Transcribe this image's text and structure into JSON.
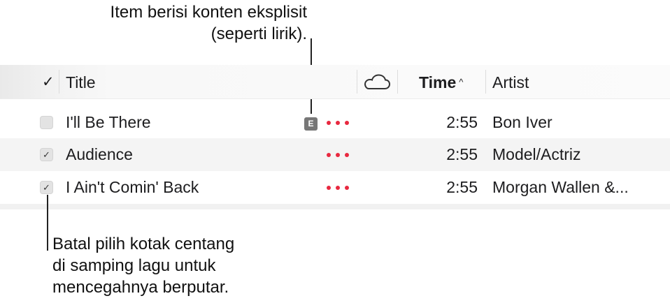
{
  "callouts": {
    "explicit_line1": "Item berisi konten eksplisit",
    "explicit_line2": "(seperti lirik).",
    "uncheck_line1": "Batal pilih kotak centang",
    "uncheck_line2": "di samping lagu untuk",
    "uncheck_line3": "mencegahnya berputar."
  },
  "header": {
    "check_symbol": "✓",
    "title": "Title",
    "cloud_icon": "cloud-icon",
    "time": "Time",
    "sort_caret": "^",
    "artist": "Artist"
  },
  "rows": [
    {
      "checked": false,
      "title": "I'll Be There",
      "explicit": true,
      "explicit_badge": "E",
      "more_icon": "ellipsis-icon",
      "time": "2:55",
      "artist": "Bon Iver"
    },
    {
      "checked": true,
      "check_symbol": "✓",
      "title": "Audience",
      "explicit": false,
      "more_icon": "ellipsis-icon",
      "time": "2:55",
      "artist": "Model/Actriz"
    },
    {
      "checked": true,
      "check_symbol": "✓",
      "title": "I Ain't Comin' Back",
      "explicit": false,
      "more_icon": "ellipsis-icon",
      "time": "2:55",
      "artist": "Morgan Wallen &..."
    }
  ],
  "colors": {
    "accent_dots": "#e8283f",
    "explicit_badge_bg": "#777777",
    "alt_row_bg": "#f4f4f4"
  }
}
